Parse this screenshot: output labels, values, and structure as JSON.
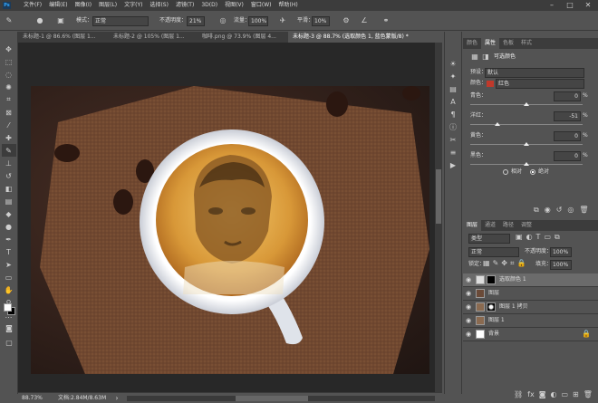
{
  "menu": [
    "文件(F)",
    "编辑(E)",
    "图像(I)",
    "图层(L)",
    "文字(Y)",
    "选择(S)",
    "滤镜(T)",
    "3D(D)",
    "视图(V)",
    "窗口(W)",
    "帮助(H)"
  ],
  "options": {
    "mode_label": "模式：",
    "mode_value": "正常",
    "opacity_label": "不透明度：",
    "opacity_value": "21%",
    "flow_label": "流量：",
    "flow_value": "100%",
    "smooth_label": "平滑：",
    "smooth_value": "10%"
  },
  "tabs": [
    "未标题-1 @ 86.6% (图层 1...",
    "未标题-2 @ 105% (图层 1...",
    "咖啡.png @ 73.9% (图层 4...",
    "未标题-3 @ 88.7% (选取颜色 1, 蓝色蒙版/8) *"
  ],
  "status": {
    "zoom": "88.73%",
    "doc": "文档:2.84M/8.63M"
  },
  "panel_tabs_top": [
    "颜色",
    "属性",
    "色板",
    "样式"
  ],
  "properties": {
    "title": "可选颜色",
    "preset_label": "预设：",
    "preset_value": "默认",
    "colors_label": "颜色：",
    "colors_value": "红色",
    "swatch_color": "#c0392b",
    "sliders": [
      {
        "label": "青色：",
        "value": "0",
        "unit": "%",
        "fraction": 0.5
      },
      {
        "label": "洋红：",
        "value": "-51",
        "unit": "%",
        "fraction": 0.245
      },
      {
        "label": "黄色：",
        "value": "0",
        "unit": "%",
        "fraction": 0.5
      },
      {
        "label": "黑色：",
        "value": "0",
        "unit": "%",
        "fraction": 0.5
      }
    ],
    "relative": "相对",
    "absolute": "绝对"
  },
  "layers_panel": {
    "tabs": [
      "图层",
      "通道",
      "路径",
      "调整"
    ],
    "kind": "类型",
    "blend": "正常",
    "opacity_label": "不透明度：",
    "opacity_value": "100%",
    "lock_label": "锁定：",
    "fill_label": "填充：",
    "fill_value": "100%",
    "layers": [
      {
        "name": "选取颜色 1",
        "selected": true
      },
      {
        "name": "图层",
        "selected": false
      },
      {
        "name": "图层 1 拷贝",
        "selected": false
      },
      {
        "name": "图层 1",
        "selected": false
      },
      {
        "name": "背景",
        "selected": false
      }
    ]
  }
}
